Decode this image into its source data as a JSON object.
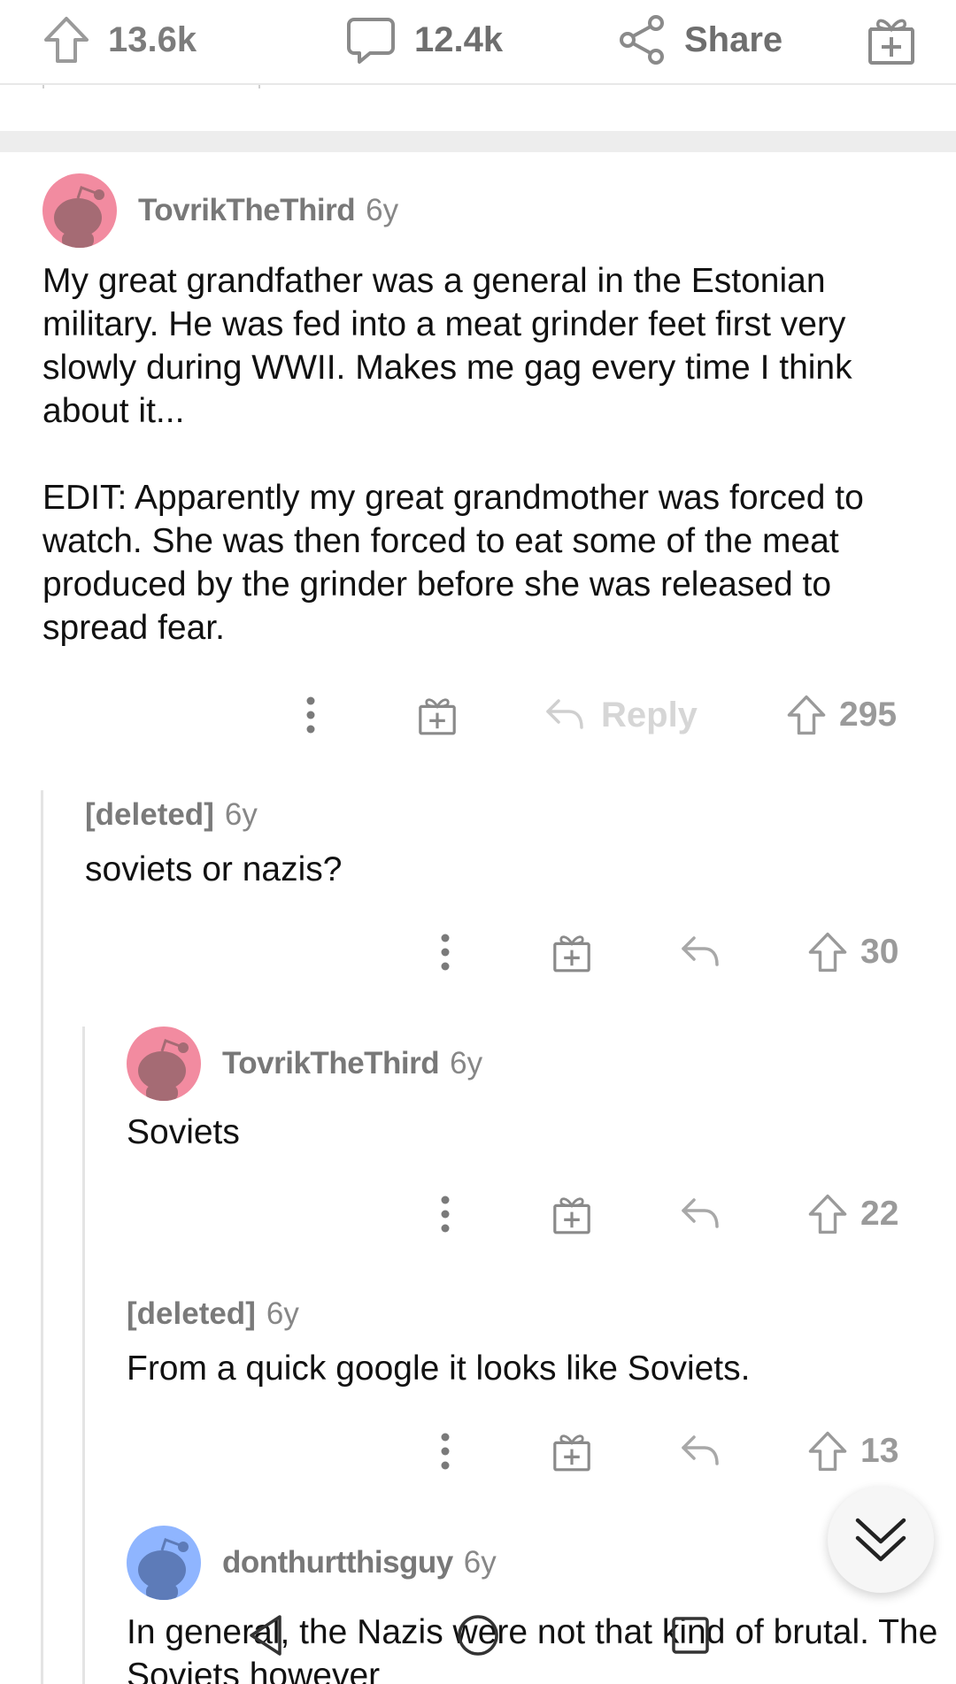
{
  "topbar": {
    "upvotes": "13.6k",
    "comments": "12.4k",
    "share_label": "Share",
    "icons": [
      "upvote-arrow-icon",
      "comment-bubble-icon",
      "share-icon",
      "gift-award-icon"
    ]
  },
  "colors": {
    "avatar_pink": "#f28ba0",
    "avatar_blue": "#8fb5ff",
    "muted_text": "#7c7c7c",
    "separator": "#ededed"
  },
  "comments": [
    {
      "username": "TovrikTheThird",
      "age": "6y",
      "paragraphs": [
        "My great grandfather was a general in the Estonian military. He was fed into a meat grinder feet first very slowly during WWII. Makes me gag every time I think about it...",
        "EDIT: Apparently my great grandmother was forced to watch. She was then forced to eat some of the meat produced by the grinder before she was released to spread fear."
      ],
      "reply_label": "Reply",
      "votes": "295"
    },
    {
      "username": "[deleted]",
      "age": "6y",
      "text": "soviets or nazis?",
      "votes": "30"
    },
    {
      "username": "TovrikTheThird",
      "age": "6y",
      "text": "Soviets",
      "votes": "22"
    },
    {
      "username": "[deleted]",
      "age": "6y",
      "text": "From a quick google it looks like Soviets.",
      "votes": "13"
    },
    {
      "username": "donthurtthisguy",
      "age": "6y",
      "text": "In general, the Nazis were not that kind of brutal. The Soviets however"
    }
  ],
  "navbar": {
    "icons": [
      "back-triangle-icon",
      "home-circle-icon",
      "recents-square-icon"
    ]
  }
}
